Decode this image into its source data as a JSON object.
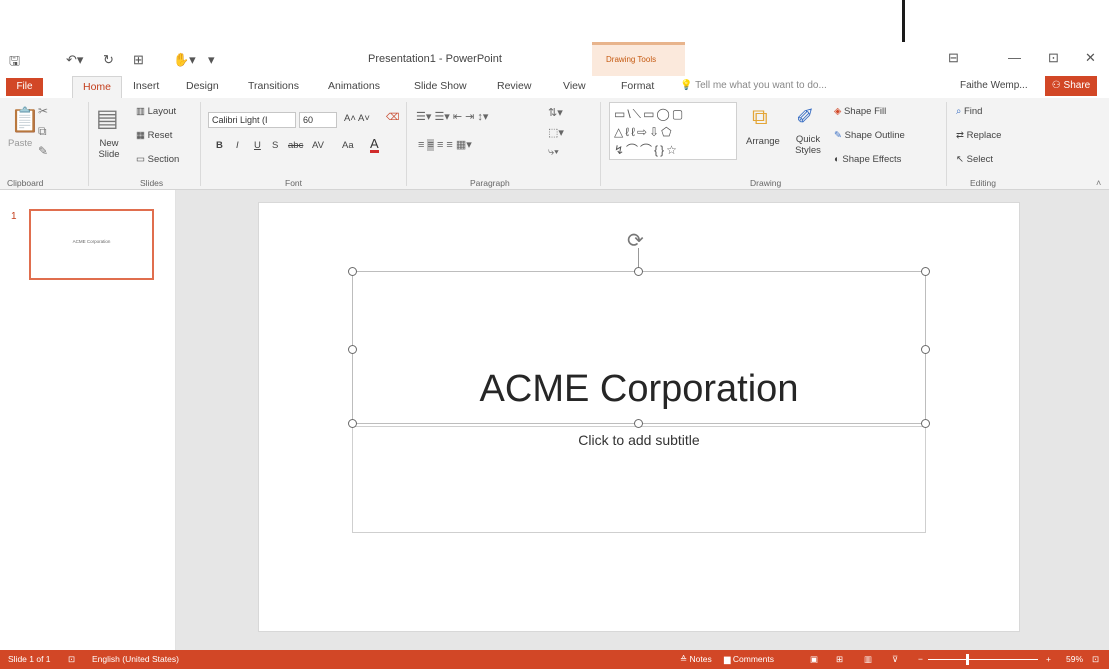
{
  "window": {
    "title": "Presentation1 - PowerPoint",
    "context_group": "Drawing Tools",
    "user": "Faithe Wemp...",
    "share": "Share",
    "minimize_symbol": "—",
    "restore_symbol": "⊡",
    "close_symbol": "✕"
  },
  "tabs": {
    "file": "File",
    "home": "Home",
    "insert": "Insert",
    "design": "Design",
    "transitions": "Transitions",
    "animations": "Animations",
    "slideshow": "Slide Show",
    "review": "Review",
    "view": "View",
    "format": "Format",
    "tell_me": "Tell me what you want to do..."
  },
  "ribbon": {
    "clipboard": {
      "label": "Clipboard",
      "paste": "Paste"
    },
    "slides": {
      "label": "Slides",
      "new_slide_1": "New",
      "new_slide_2": "Slide",
      "layout": "Layout",
      "reset": "Reset",
      "section": "Section"
    },
    "font": {
      "label": "Font",
      "font_name": "Calibri Light (I",
      "font_size": "60",
      "bold": "B",
      "italic": "I",
      "underline": "U",
      "shadow": "S",
      "strike": "abc",
      "spacing": "AV",
      "case": "Aa",
      "color": "A"
    },
    "paragraph": {
      "label": "Paragraph"
    },
    "drawing": {
      "label": "Drawing",
      "arrange": "Arrange",
      "quick_styles_1": "Quick",
      "quick_styles_2": "Styles",
      "shape_fill": "Shape Fill",
      "shape_outline": "Shape Outline",
      "shape_effects": "Shape Effects",
      "shapes_row1": "▭\\⟍▭◯▢",
      "shapes_row2": "△ℓℓ⇨⇩⬠",
      "shapes_row3": "↯⌒⌒{}☆"
    },
    "editing": {
      "label": "Editing",
      "find": "Find",
      "replace": "Replace",
      "select": "Select"
    }
  },
  "thumbnails": [
    {
      "number": "1",
      "text": "ACME Corporation"
    }
  ],
  "slide": {
    "title": "ACME Corporation",
    "subtitle_placeholder": "Click to add subtitle"
  },
  "statusbar": {
    "slide_info": "Slide 1 of 1",
    "language": "English (United States)",
    "notes": "Notes",
    "comments": "Comments",
    "zoom": "59%"
  }
}
